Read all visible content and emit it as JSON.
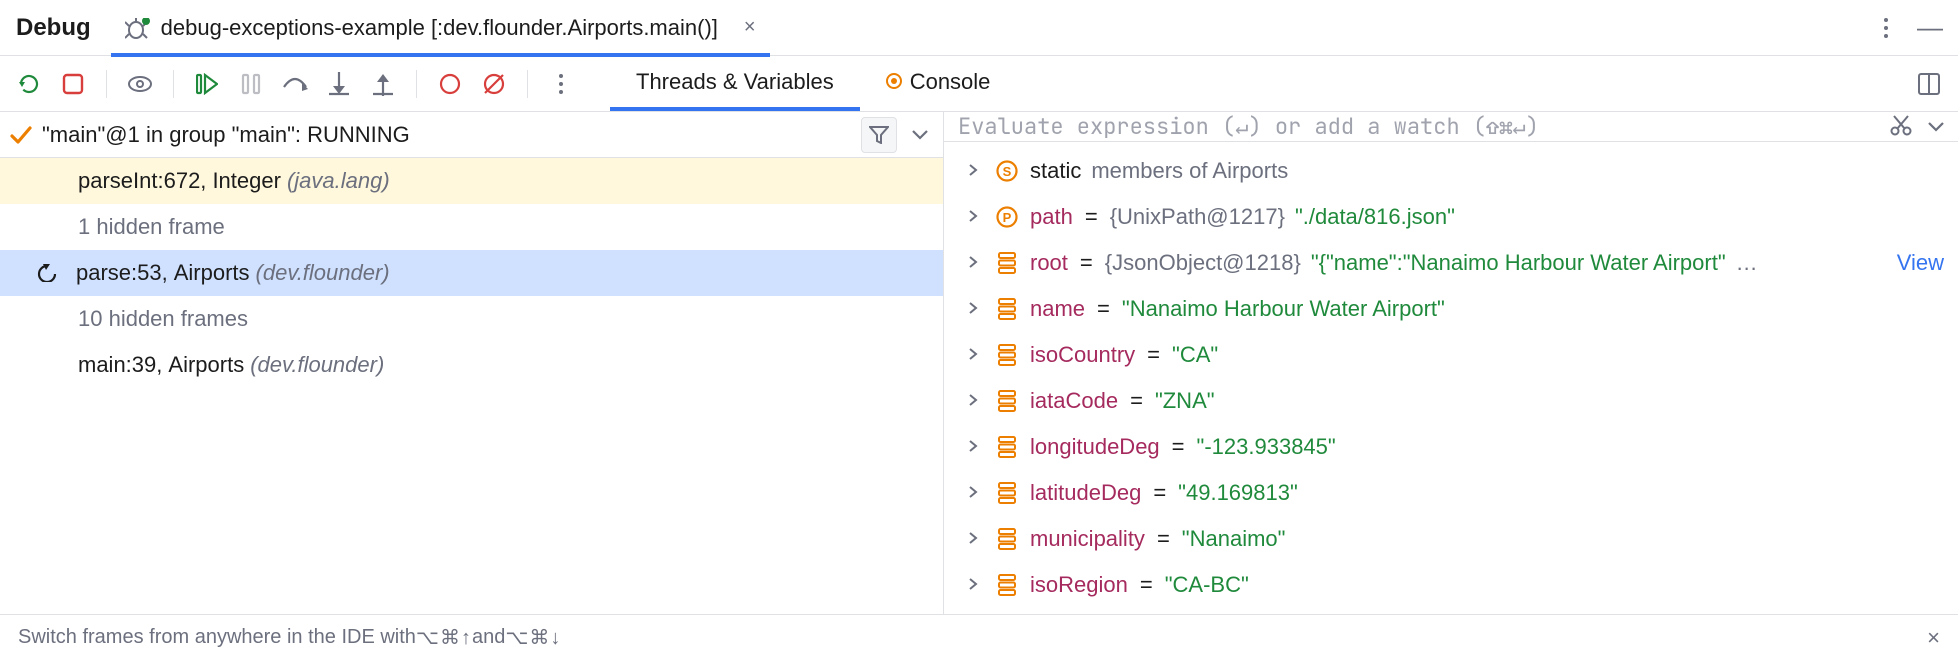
{
  "title": "Debug",
  "run_tab": {
    "label": "debug-exceptions-example [:dev.flounder.Airports.main()]"
  },
  "view_tabs": {
    "threads": "Threads & Variables",
    "console": "Console",
    "active": "threads"
  },
  "frames": {
    "thread_label": "\"main\"@1 in group \"main\": RUNNING",
    "items": [
      {
        "kind": "frame",
        "style": "highlight",
        "method": "parseInt",
        "line": 672,
        "class": "Integer",
        "package": "(java.lang)"
      },
      {
        "kind": "info",
        "text": "1 hidden frame"
      },
      {
        "kind": "frame",
        "style": "selected",
        "icon": "drop",
        "method": "parse",
        "line": 53,
        "class": "Airports",
        "package": "(dev.flounder)"
      },
      {
        "kind": "info",
        "text": "10 hidden frames"
      },
      {
        "kind": "frame",
        "style": "plain",
        "method": "main",
        "line": 39,
        "class": "Airports",
        "package": "(dev.flounder)"
      }
    ]
  },
  "eval": {
    "placeholder": "Evaluate expression (↵) or add a watch (⇧⌘↵)"
  },
  "variables": [
    {
      "icon": "static",
      "name": "static",
      "suffix": "members of Airports"
    },
    {
      "icon": "param",
      "name": "path",
      "type": "{UnixPath@1217}",
      "str": "\"./data/816.json\""
    },
    {
      "icon": "seg",
      "name": "root",
      "type": "{JsonObject@1218}",
      "str": "\"{\"name\":\"Nanaimo Harbour Water Airport\"",
      "truncated": true,
      "view": "View"
    },
    {
      "icon": "seg",
      "name": "name",
      "str": "\"Nanaimo Harbour Water Airport\""
    },
    {
      "icon": "seg",
      "name": "isoCountry",
      "str": "\"CA\""
    },
    {
      "icon": "seg",
      "name": "iataCode",
      "str": "\"ZNA\""
    },
    {
      "icon": "seg",
      "name": "longitudeDeg",
      "str": "\"-123.933845\""
    },
    {
      "icon": "seg",
      "name": "latitudeDeg",
      "str": "\"49.169813\""
    },
    {
      "icon": "seg",
      "name": "municipality",
      "str": "\"Nanaimo\""
    },
    {
      "icon": "seg",
      "name": "isoRegion",
      "str": "\"CA-BC\""
    }
  ],
  "hint": {
    "text_prefix": "Switch frames from anywhere in the IDE with ",
    "kbd1": "⌥⌘↑",
    "mid": " and ",
    "kbd2": "⌥⌘↓"
  }
}
